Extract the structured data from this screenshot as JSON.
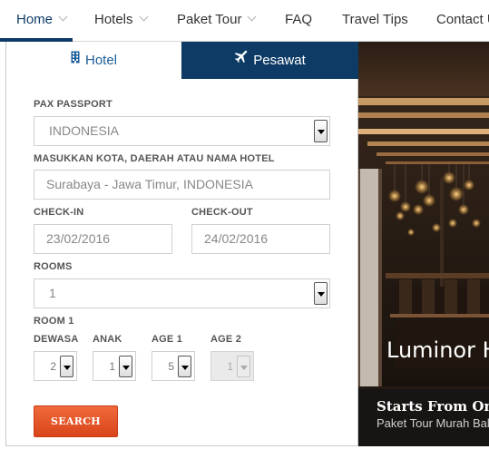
{
  "nav": {
    "items": [
      {
        "label": "Home",
        "has_dropdown": true,
        "active": true
      },
      {
        "label": "Hotels",
        "has_dropdown": true,
        "active": false
      },
      {
        "label": "Paket Tour",
        "has_dropdown": true,
        "active": false
      },
      {
        "label": "FAQ",
        "has_dropdown": false,
        "active": false
      },
      {
        "label": "Travel Tips",
        "has_dropdown": false,
        "active": false
      },
      {
        "label": "Contact Us",
        "has_dropdown": false,
        "active": false
      }
    ]
  },
  "tabs": {
    "hotel": {
      "label": "Hotel",
      "icon": "building-icon",
      "active": true
    },
    "pesawat": {
      "label": "Pesawat",
      "icon": "plane-icon",
      "active": false
    }
  },
  "form": {
    "pax_passport_label": "PAX PASSPORT",
    "pax_passport_value": "INDONESIA",
    "destination_label": "MASUKKAN KOTA, DAERAH ATAU NAMA HOTEL",
    "destination_value": "Surabaya - Jawa Timur, INDONESIA",
    "checkin_label": "CHECK-IN",
    "checkin_value": "23/02/2016",
    "checkout_label": "CHECK-OUT",
    "checkout_value": "24/02/2016",
    "rooms_label": "ROOMS",
    "rooms_value": "1",
    "room1_label": "ROOM 1",
    "dewasa_label": "DEWASA",
    "dewasa_value": "2",
    "anak_label": "ANAK",
    "anak_value": "1",
    "age1_label": "AGE 1",
    "age1_value": "5",
    "age2_label": "AGE 2",
    "age2_value": "1",
    "search_label": "SEARCH"
  },
  "promo": {
    "title": "Luminor Hotel",
    "starts_from": "Starts From Only",
    "subtitle": "Paket Tour Murah Bali"
  },
  "colors": {
    "primary": "#0e3b66",
    "accent": "#e65428"
  }
}
